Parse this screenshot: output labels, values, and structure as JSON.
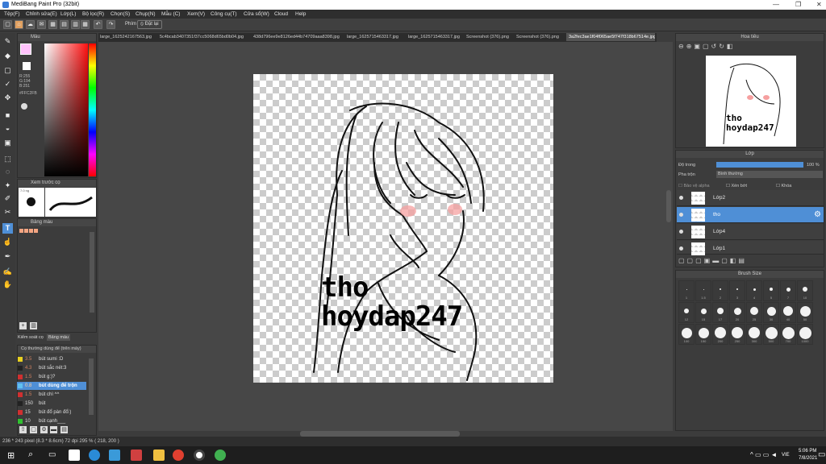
{
  "window": {
    "title": "MediBang Paint Pro (32bit)"
  },
  "menu": [
    "Tệp(F)",
    "Chỉnh sửa(E)",
    "Lớp(L)",
    "Bộ lọc(R)",
    "Chọn(S)",
    "Chụp(N)",
    "Mẫu (C)",
    "Xem(V)",
    "Công cụ(T)",
    "Cửa sổ(W)",
    "Cloud",
    "Help"
  ],
  "toolbar": {
    "phim_label": "Phím",
    "snap_label": "Đặt lại"
  },
  "tabs": [
    "large_1625242167563.jpg",
    "5c4bcab3407351f37cc5068d65bd0b04.jpg",
    "438d796ee9e8126ed44b74709aaa8398.jpg",
    "large_1625715463317.jpg",
    "large_1625715463317.jpg",
    "Screenshot (376).png",
    "Screenshot (376).png",
    "3a2fec3ae1f04f065ae5f747f318b67514e.jpg"
  ],
  "color_panel": {
    "title": "Màu",
    "r": "R:255",
    "g": "G:194",
    "b": "B:251",
    "hex": "#FFC2FB"
  },
  "brush_preview": {
    "title": "Xem trước cọ",
    "size": "7.0 ng"
  },
  "palette": {
    "title": "Bảng màu",
    "colors": [
      "#f4a582",
      "#f4a582",
      "#f4a582",
      "#f4a582"
    ]
  },
  "sub_tabs": [
    "Kiểm soát cọ",
    "Bảng màu"
  ],
  "brush_list": {
    "title": "Cọ thường dùng để (trên máy)",
    "items": [
      {
        "color": "#e8d020",
        "size": "3.5",
        "label": "bút sumi :D"
      },
      {
        "color": "#222222",
        "size": "4.3",
        "label": "bút sắc nét:3"
      },
      {
        "color": "#d03030",
        "size": "1.5",
        "label": "bút g:)?"
      },
      {
        "color": "#60c0f0",
        "size": "0.8",
        "label": "bút dùng để trộn"
      },
      {
        "color": "#d03030",
        "size": "1.5",
        "label": "bút chì ^^"
      },
      {
        "color": "#222222",
        "size": "150",
        "label": "bút"
      },
      {
        "color": "#d03030",
        "size": "15",
        "label": "bút đổ pàn đổ:)"
      },
      {
        "color": "#30c030",
        "size": "10",
        "label": "bút cạnh___"
      }
    ]
  },
  "navigator": {
    "title": "Hoa tiêu"
  },
  "layer_panel": {
    "title": "Lớp",
    "opacity_label": "Độ trong",
    "opacity_value": "100 %",
    "blend_label": "Pha trộn",
    "blend_value": "Bình thường",
    "protect_alpha": "Bảo vệ alpha",
    "clipping": "Xén bớt",
    "lock": "Khóa",
    "layers": [
      {
        "name": "Lớp2",
        "selected": false
      },
      {
        "name": "tho",
        "selected": true
      },
      {
        "name": "Lớp4",
        "selected": false
      },
      {
        "name": "Lớp1",
        "selected": false
      }
    ]
  },
  "brush_size": {
    "title": "Brush Size",
    "row1": [
      "1",
      "1.5",
      "2",
      "3",
      "4",
      "5",
      "7",
      "10"
    ],
    "row2": [
      "12",
      "15",
      "17",
      "20",
      "25",
      "30",
      "40",
      "50"
    ],
    "row3": [
      "100",
      "150",
      "200",
      "250",
      "300",
      "500",
      "700",
      "1000"
    ]
  },
  "artwork": {
    "text_line1": "tho",
    "text_line2": "hoydap247"
  },
  "status": {
    "text": "236 * 243 pixel  (8.3 * 8.6cm)  72 dpi  295 %  ( 218, 200 )"
  },
  "taskbar": {
    "lang": "VIE",
    "time": "5:06 PM",
    "date": "7/8/2021"
  }
}
